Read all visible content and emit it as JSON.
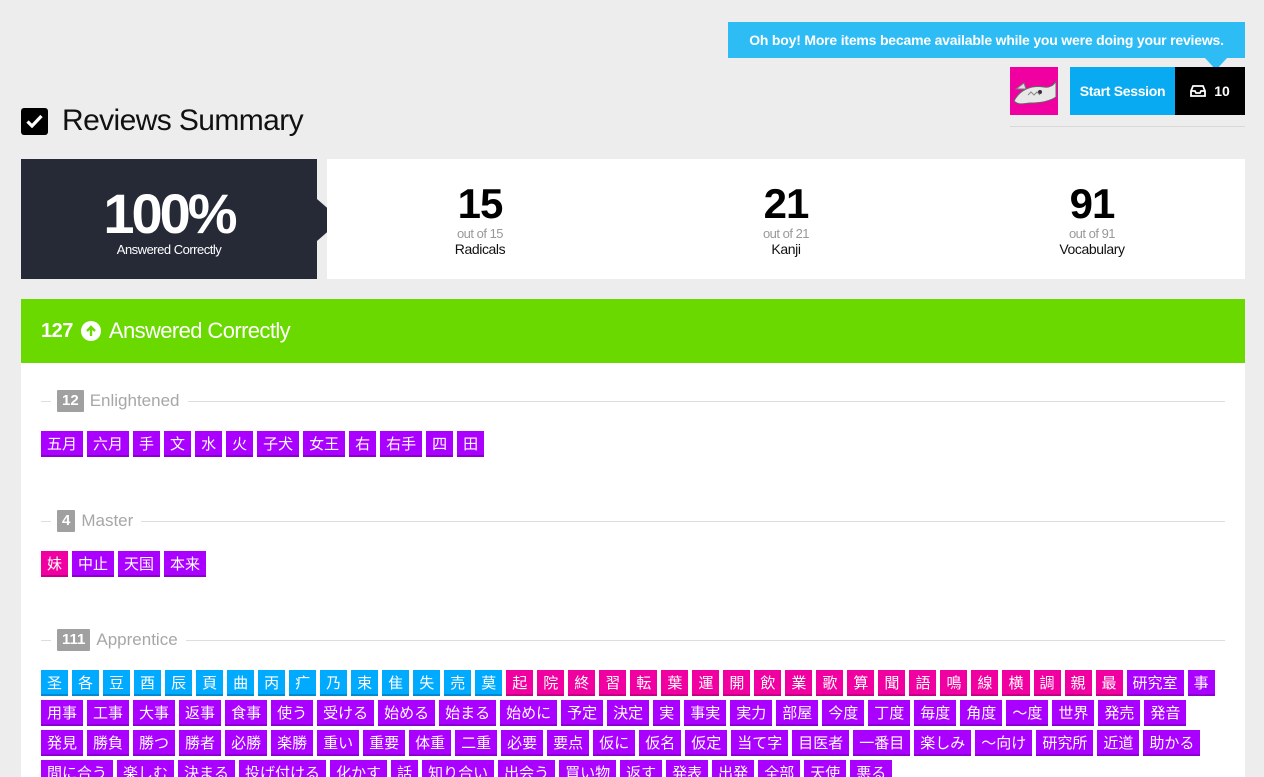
{
  "tooltip": "Oh boy! More items became available while you were doing your reviews.",
  "header": {
    "start_label": "Start Session",
    "queue_count": "10"
  },
  "title": "Reviews Summary",
  "score": {
    "percent": "100%",
    "label": "Answered Correctly"
  },
  "counts": [
    {
      "num": "15",
      "out": "out of 15",
      "label": "Radicals"
    },
    {
      "num": "21",
      "out": "out of 21",
      "label": "Kanji"
    },
    {
      "num": "91",
      "out": "out of 91",
      "label": "Vocabulary"
    }
  ],
  "correct": {
    "count": "127",
    "label": "Answered Correctly"
  },
  "colors": {
    "radical": "#00aaff",
    "kanji": "#f100a1",
    "vocab": "#aa00ff",
    "correct": "#6ad900"
  },
  "groups": [
    {
      "count": "12",
      "name": "Enlightened",
      "items": [
        [
          "v",
          "五月"
        ],
        [
          "v",
          "六月"
        ],
        [
          "v",
          "手"
        ],
        [
          "v",
          "文"
        ],
        [
          "v",
          "水"
        ],
        [
          "v",
          "火"
        ],
        [
          "v",
          "子犬"
        ],
        [
          "v",
          "女王"
        ],
        [
          "v",
          "右"
        ],
        [
          "v",
          "右手"
        ],
        [
          "v",
          "四"
        ],
        [
          "v",
          "田"
        ]
      ]
    },
    {
      "count": "4",
      "name": "Master",
      "items": [
        [
          "k",
          "妹"
        ],
        [
          "v",
          "中止"
        ],
        [
          "v",
          "天国"
        ],
        [
          "v",
          "本来"
        ]
      ]
    },
    {
      "count": "111",
      "name": "Apprentice",
      "items": [
        [
          "r",
          "圣"
        ],
        [
          "r",
          "各"
        ],
        [
          "r",
          "豆"
        ],
        [
          "r",
          "酉"
        ],
        [
          "r",
          "辰"
        ],
        [
          "r",
          "頁"
        ],
        [
          "r",
          "曲"
        ],
        [
          "r",
          "丙"
        ],
        [
          "r",
          "疒"
        ],
        [
          "r",
          "乃"
        ],
        [
          "r",
          "束"
        ],
        [
          "r",
          "隹"
        ],
        [
          "r",
          "失"
        ],
        [
          "r",
          "売"
        ],
        [
          "r",
          "莫"
        ],
        [
          "k",
          "起"
        ],
        [
          "k",
          "院"
        ],
        [
          "k",
          "終"
        ],
        [
          "k",
          "習"
        ],
        [
          "k",
          "転"
        ],
        [
          "k",
          "葉"
        ],
        [
          "k",
          "運"
        ],
        [
          "k",
          "開"
        ],
        [
          "k",
          "飲"
        ],
        [
          "k",
          "業"
        ],
        [
          "k",
          "歌"
        ],
        [
          "k",
          "算"
        ],
        [
          "k",
          "聞"
        ],
        [
          "k",
          "語"
        ],
        [
          "k",
          "鳴"
        ],
        [
          "k",
          "線"
        ],
        [
          "k",
          "横"
        ],
        [
          "k",
          "調"
        ],
        [
          "k",
          "親"
        ],
        [
          "k",
          "最"
        ],
        [
          "v",
          "研究室"
        ],
        [
          "v",
          "事"
        ],
        [
          "v",
          "用事"
        ],
        [
          "v",
          "工事"
        ],
        [
          "v",
          "大事"
        ],
        [
          "v",
          "返事"
        ],
        [
          "v",
          "食事"
        ],
        [
          "v",
          "使う"
        ],
        [
          "v",
          "受ける"
        ],
        [
          "v",
          "始める"
        ],
        [
          "v",
          "始まる"
        ],
        [
          "v",
          "始めに"
        ],
        [
          "v",
          "予定"
        ],
        [
          "v",
          "決定"
        ],
        [
          "v",
          "実"
        ],
        [
          "v",
          "事実"
        ],
        [
          "v",
          "実力"
        ],
        [
          "v",
          "部屋"
        ],
        [
          "v",
          "今度"
        ],
        [
          "v",
          "丁度"
        ],
        [
          "v",
          "毎度"
        ],
        [
          "v",
          "角度"
        ],
        [
          "v",
          "〜度"
        ],
        [
          "v",
          "世界"
        ],
        [
          "v",
          "発売"
        ],
        [
          "v",
          "発音"
        ],
        [
          "v",
          "発見"
        ],
        [
          "v",
          "勝負"
        ],
        [
          "v",
          "勝つ"
        ],
        [
          "v",
          "勝者"
        ],
        [
          "v",
          "必勝"
        ],
        [
          "v",
          "楽勝"
        ],
        [
          "v",
          "重い"
        ],
        [
          "v",
          "重要"
        ],
        [
          "v",
          "体重"
        ],
        [
          "v",
          "二重"
        ],
        [
          "v",
          "必要"
        ],
        [
          "v",
          "要点"
        ],
        [
          "v",
          "仮に"
        ],
        [
          "v",
          "仮名"
        ],
        [
          "v",
          "仮定"
        ],
        [
          "v",
          "当て字"
        ],
        [
          "v",
          "目医者"
        ],
        [
          "v",
          "一番目"
        ],
        [
          "v",
          "楽しみ"
        ],
        [
          "v",
          "〜向け"
        ],
        [
          "v",
          "研究所"
        ],
        [
          "v",
          "近道"
        ],
        [
          "v",
          "助かる"
        ],
        [
          "v",
          "間に合う"
        ],
        [
          "v",
          "楽しむ"
        ],
        [
          "v",
          "決まる"
        ],
        [
          "v",
          "投げ付ける"
        ],
        [
          "v",
          "化かす"
        ],
        [
          "v",
          "話"
        ],
        [
          "v",
          "知り合い"
        ],
        [
          "v",
          "出会う"
        ],
        [
          "v",
          "買い物"
        ],
        [
          "v",
          "返す"
        ],
        [
          "v",
          "発表"
        ],
        [
          "v",
          "出発"
        ],
        [
          "v",
          "全部"
        ],
        [
          "v",
          "天使"
        ],
        [
          "v",
          "悪る"
        ]
      ]
    }
  ]
}
